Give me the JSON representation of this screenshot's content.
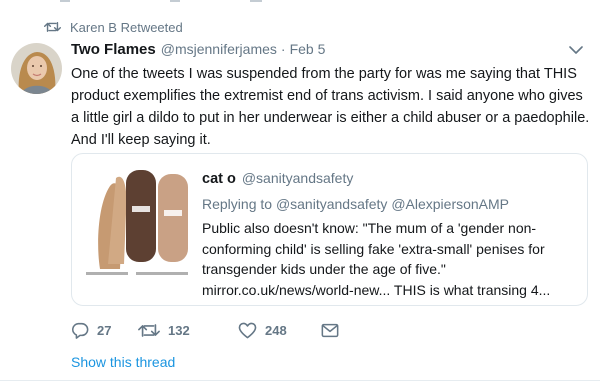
{
  "retweet_context": {
    "icon": "retweet-icon",
    "text": "Karen B Retweeted"
  },
  "tweet": {
    "author_name": "Two Flames",
    "author_handle": "@msjenniferjames",
    "separator": "·",
    "timestamp": "Feb 5",
    "caret_icon": "chevron-down-icon",
    "text": "One of the tweets I was suspended from the party for was me saying that THIS product exemplifies the extremist end of trans activism. I said anyone who gives a little girl a dildo to put in her underwear is either a child abuser or a paedophile. And I'll keep saying it."
  },
  "quoted_tweet": {
    "author_name": "cat o",
    "author_handle": "@sanityandsafety",
    "reply_prefix": "Replying to",
    "reply_to": "@sanityandsafety @AlexpiersonAMP",
    "text": "Public also doesn't know: \"The mum of a 'gender non-conforming child' is selling fake 'extra-small' penises for transgender kids under the age of five.\" mirror.co.uk/news/world-new... THIS is what transing 4..."
  },
  "actions": {
    "reply_count": "27",
    "retweet_count": "132",
    "like_count": "248",
    "icons": [
      "reply-icon",
      "retweet-icon",
      "heart-icon",
      "message-icon"
    ]
  },
  "show_thread_label": "Show this thread",
  "colors": {
    "text": "#14171a",
    "secondary": "#657786",
    "link": "#1b95e0",
    "border": "#e1e8ed"
  }
}
